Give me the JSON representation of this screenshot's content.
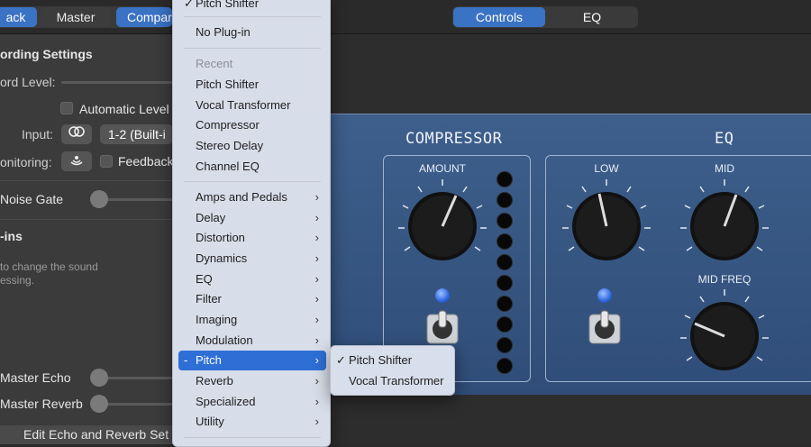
{
  "topbar": {
    "tabs_left": [
      "ack",
      "Master",
      "Compar"
    ],
    "tabs_right": [
      "Controls",
      "EQ"
    ]
  },
  "left_panel": {
    "recording_settings_heading": "ording Settings",
    "record_level_label": "ord Level:",
    "automatic_level_label": "Automatic Level",
    "input_label": "Input:",
    "input_value": "1-2  (Built-i",
    "monitoring_label": "onitoring:",
    "feedback_label": "Feedback",
    "noise_gate_label": "Noise Gate",
    "plugins_heading": "-ins",
    "plugins_help_line1": "to change the sound",
    "plugins_help_line2": "essing.",
    "master_echo_label": "Master Echo",
    "master_reverb_label": "Master Reverb",
    "edit_button_label": "Edit Echo and Reverb Set"
  },
  "menu": {
    "selected_top": "Pitch Shifter",
    "no_plugin": "No Plug-in",
    "recent_header": "Recent",
    "recent_items": [
      "Pitch Shifter",
      "Vocal Transformer",
      "Compressor",
      "Stereo Delay",
      "Channel EQ"
    ],
    "categories": [
      "Amps and Pedals",
      "Delay",
      "Distortion",
      "Dynamics",
      "EQ",
      "Filter",
      "Imaging",
      "Modulation",
      "Pitch",
      "Reverb",
      "Specialized",
      "Utility"
    ],
    "highlighted_prefix": "-",
    "arrow": "›",
    "checkmark": "✓"
  },
  "submenu": {
    "items": [
      "Pitch Shifter",
      "Vocal Transformer"
    ]
  },
  "plugin": {
    "compressor_title": "COMPRESSOR",
    "eq_title": "EQ",
    "amount_label": "AMOUNT",
    "low_label": "LOW",
    "mid_label": "MID",
    "mid_freq_label": "MID FREQ"
  }
}
